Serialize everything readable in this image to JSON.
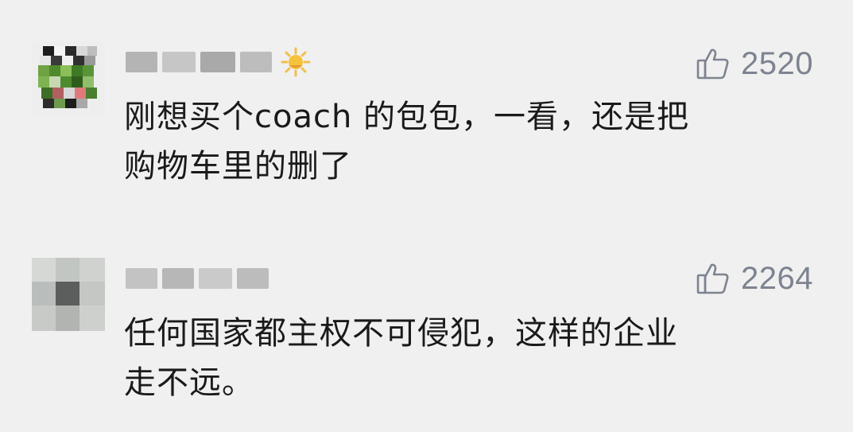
{
  "comments": [
    {
      "username": "",
      "likes": "2520",
      "text_line1": "刚想买个coach 的包包，一看，还是把",
      "text_line2": "购物车里的删了",
      "badge": "sun-badge-icon"
    },
    {
      "username": "",
      "likes": "2264",
      "text_line1": "任何国家都主权不可侵犯，这样的企业",
      "text_line2": "走不远。"
    }
  ],
  "colors": {
    "background": "#f0f0f0",
    "text": "#1a1a1a",
    "like": "#7d8390"
  }
}
